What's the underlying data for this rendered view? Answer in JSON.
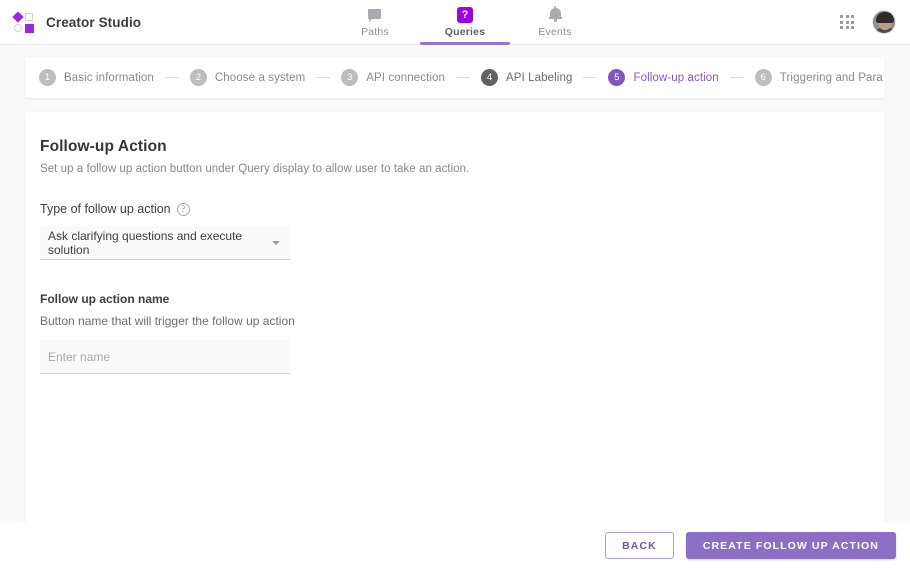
{
  "app": {
    "brand_name": "Creator Studio",
    "logo_icon": "creator-studio-logo",
    "accent_purple": "#7e57c2",
    "brand_purple": "#9c27e0",
    "button_purple": "#8a6fc4"
  },
  "nav": {
    "tabs": [
      {
        "label": "Paths",
        "icon": "chat-bubble-icon",
        "active": false
      },
      {
        "label": "Queries",
        "icon": "question-badge-icon",
        "active": true
      },
      {
        "label": "Events",
        "icon": "bell-icon",
        "active": false
      }
    ],
    "apps_icon": "apps-grid-icon",
    "avatar_icon": "user-avatar"
  },
  "stepper": {
    "steps": [
      {
        "number": "1",
        "label": "Basic information",
        "state": "pending"
      },
      {
        "number": "2",
        "label": "Choose a system",
        "state": "pending"
      },
      {
        "number": "3",
        "label": "API connection",
        "state": "pending"
      },
      {
        "number": "4",
        "label": "API Labeling",
        "state": "done"
      },
      {
        "number": "5",
        "label": "Follow-up action",
        "state": "active"
      },
      {
        "number": "6",
        "label": "Triggering and Para",
        "state": "pending"
      }
    ]
  },
  "main": {
    "title": "Follow-up Action",
    "subtitle": "Set up a follow up action button under Query display to allow user to take an action.",
    "type_field": {
      "label": "Type of follow up action",
      "help_icon": "help-circle-icon",
      "selected": "Ask clarifying questions and execute solution",
      "caret_icon": "chevron-down-icon"
    },
    "name_field": {
      "label": "Follow up action name",
      "description": "Button name that will trigger the follow up action",
      "placeholder": "Enter name",
      "value": ""
    }
  },
  "footer": {
    "back_label": "BACK",
    "create_label": "CREATE FOLLOW UP ACTION"
  }
}
